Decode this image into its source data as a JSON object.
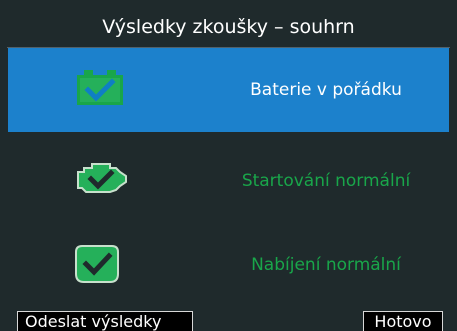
{
  "header": {
    "title": "Výsledky zkoušky – souhrn"
  },
  "results": [
    {
      "icon": "battery-check-icon",
      "label": "Baterie v pořádku"
    },
    {
      "icon": "engine-check-icon",
      "label": "Startování normální"
    },
    {
      "icon": "alternator-check-icon",
      "label": "Nabíjení normální"
    }
  ],
  "buttons": {
    "send": "Odeslat výsledky",
    "done": "Hotovo"
  },
  "colors": {
    "background": "#1f2a2c",
    "highlight": "#1c81cc",
    "ok_green": "#19a64a",
    "check_blue": "#0f7fc4"
  }
}
